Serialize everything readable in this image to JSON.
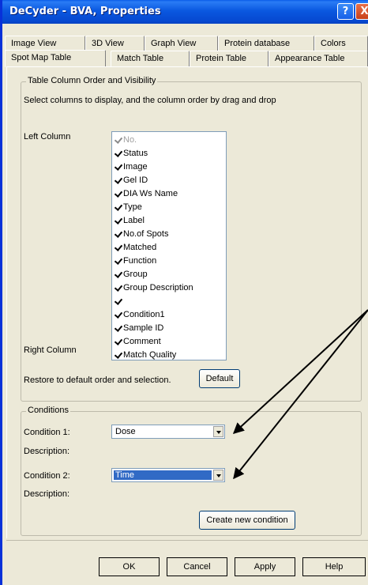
{
  "window": {
    "title": "DeCyder - BVA, Properties",
    "help_glyph": "?",
    "close_glyph": "X"
  },
  "tabs_row1": [
    "Image View",
    "3D View",
    "Graph View",
    "Protein database",
    "Colors"
  ],
  "tabs_row2": [
    "Spot Map Table",
    "Match Table",
    "Protein Table",
    "Appearance Table"
  ],
  "active_tab": "Spot Map Table",
  "columns_group": {
    "title": "Table Column Order and Visibility",
    "instruction": "Select columns to display, and the column order by drag and drop",
    "left_label": "Left Column",
    "right_label": "Right Column",
    "items": [
      {
        "label": "No.",
        "checked": true,
        "disabled": true
      },
      {
        "label": "Status",
        "checked": true
      },
      {
        "label": "Image",
        "checked": true
      },
      {
        "label": "Gel ID",
        "checked": true
      },
      {
        "label": "DIA Ws Name",
        "checked": true
      },
      {
        "label": "Type",
        "checked": true
      },
      {
        "label": "Label",
        "checked": true
      },
      {
        "label": "No.of Spots",
        "checked": true
      },
      {
        "label": "Matched",
        "checked": true
      },
      {
        "label": "Function",
        "checked": true
      },
      {
        "label": "Group",
        "checked": true
      },
      {
        "label": "Group Description",
        "checked": true
      },
      {
        "label": "",
        "checked": true
      },
      {
        "label": "Condition1",
        "checked": true
      },
      {
        "label": "Sample ID",
        "checked": true
      },
      {
        "label": "Comment",
        "checked": true
      },
      {
        "label": "Match Quality",
        "checked": true
      }
    ],
    "restore_text": "Restore to default order and selection.",
    "default_button": "Default"
  },
  "conditions_group": {
    "title": "Conditions",
    "condition1_label": "Condition 1:",
    "condition1_value": "Dose",
    "description1_label": "Description:",
    "condition2_label": "Condition 2:",
    "condition2_value": "Time",
    "description2_label": "Description:",
    "create_button": "Create new condition"
  },
  "footer": {
    "ok": "OK",
    "cancel": "Cancel",
    "apply": "Apply",
    "help": "Help"
  }
}
